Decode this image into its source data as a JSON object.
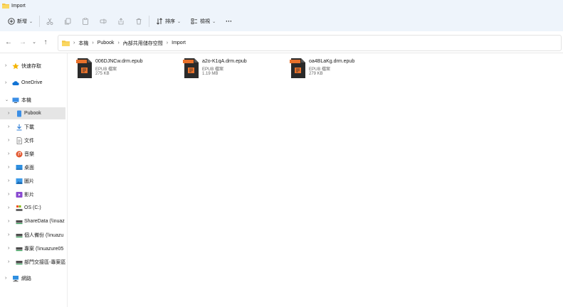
{
  "window": {
    "title": "Import"
  },
  "toolbar": {
    "new_label": "新增",
    "sort_label": "排序",
    "view_label": "檢視",
    "more_label": "···"
  },
  "address": {
    "crumbs": [
      "本機",
      "Pubook",
      "內部共用儲存空間",
      "Import"
    ]
  },
  "sidebar": {
    "items": [
      {
        "label": "快速存取",
        "icon": "star-icon"
      },
      {
        "label": "OneDrive",
        "icon": "cloud-icon"
      },
      {
        "label": "本機",
        "icon": "pc-icon"
      },
      {
        "label": "Pubook",
        "icon": "phone-icon"
      },
      {
        "label": "下載",
        "icon": "download-icon"
      },
      {
        "label": "文件",
        "icon": "document-icon"
      },
      {
        "label": "音樂",
        "icon": "music-icon"
      },
      {
        "label": "桌面",
        "icon": "desktop-icon"
      },
      {
        "label": "圖片",
        "icon": "pictures-icon"
      },
      {
        "label": "影片",
        "icon": "videos-icon"
      },
      {
        "label": "OS (C:)",
        "icon": "drive-icon"
      },
      {
        "label": "ShareData (\\\\nuaz",
        "icon": "network-drive-icon"
      },
      {
        "label": "個人備份 (\\\\nuazu",
        "icon": "network-drive-icon"
      },
      {
        "label": "專案 (\\\\nuazure05",
        "icon": "network-drive-icon"
      },
      {
        "label": "部門交接區-專案區",
        "icon": "network-drive-icon"
      },
      {
        "label": "網路",
        "icon": "network-icon"
      }
    ]
  },
  "files": [
    {
      "name": "006DJNCw.drm.epub",
      "type": "EPUB 檔案",
      "size": "275 KB",
      "icon_text": "EPUB"
    },
    {
      "name": "a2o-K1qA.drm.epub",
      "type": "EPUB 檔案",
      "size": "1.19 MB",
      "icon_text": "EPUB"
    },
    {
      "name": "oa4BLaKg.drm.epub",
      "type": "EPUB 檔案",
      "size": "279 KB",
      "icon_text": "EPUB"
    }
  ],
  "colors": {
    "chrome": "#eef4fb",
    "epub_orange": "#e8712b",
    "epub_dark": "#2a2a2a",
    "folder_yellow": "#f4c542",
    "selected": "#e5e5e5"
  }
}
